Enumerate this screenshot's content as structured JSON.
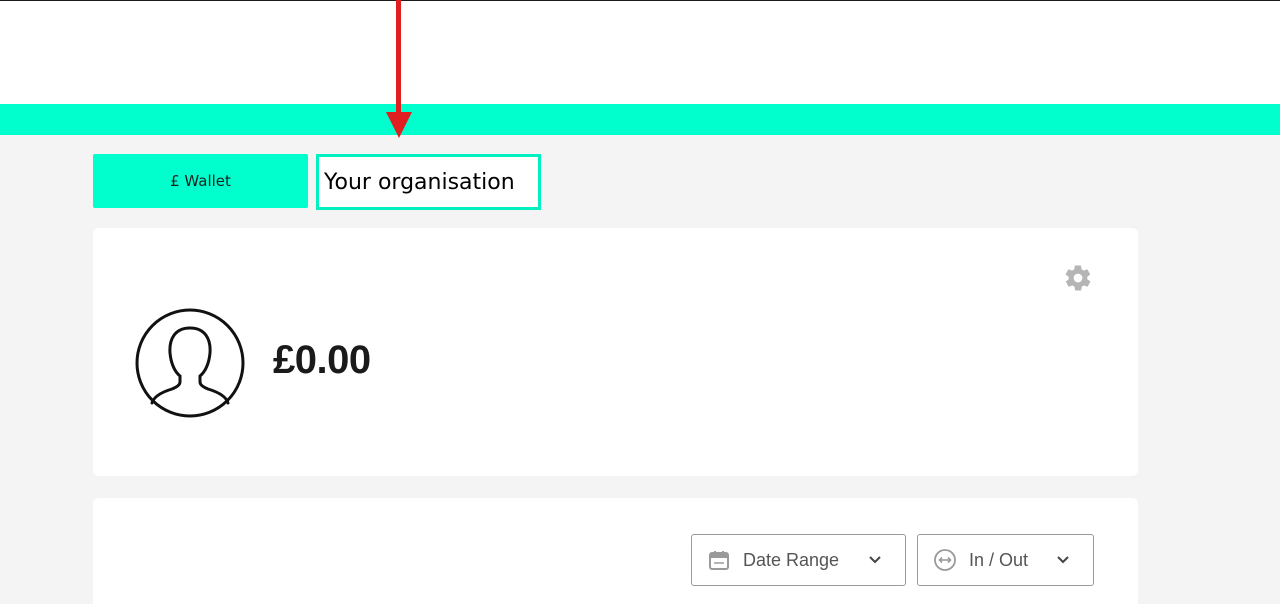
{
  "tabs": {
    "wallet_label": "£ Wallet",
    "organisation_label": "Your organisation"
  },
  "balance": {
    "amount": "£0.00"
  },
  "filters": {
    "date_range_label": "Date Range",
    "in_out_label": "In / Out"
  },
  "icons": {
    "avatar": "user-avatar-icon",
    "settings": "gear-icon",
    "date": "calendar-icon",
    "in_out": "transfer-arrows-icon",
    "chevron": "chevron-down-icon"
  },
  "colors": {
    "accent": "#00ffcc",
    "annotation_arrow": "#e02020",
    "background": "#f4f4f4"
  }
}
